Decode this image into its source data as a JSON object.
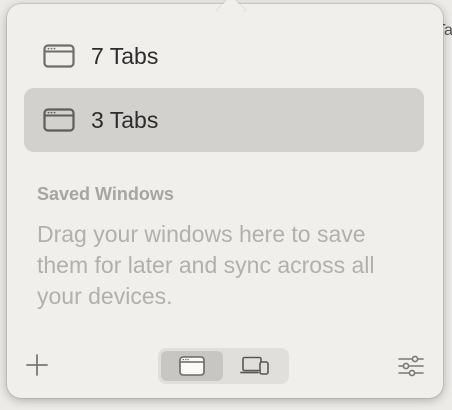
{
  "background": {
    "partial_text": "Ta"
  },
  "popover": {
    "tab_groups": [
      {
        "label": "7 Tabs",
        "icon": "browser-window-icon",
        "selected": false
      },
      {
        "label": "3 Tabs",
        "icon": "browser-window-icon",
        "selected": true
      }
    ],
    "saved_windows": {
      "title": "Saved Windows",
      "description": "Drag your windows here to save them for later and sync across all your devices."
    },
    "toolbar": {
      "add_icon": "plus-icon",
      "segments": [
        {
          "icon": "browser-window-icon",
          "active": true
        },
        {
          "icon": "devices-icon",
          "active": false
        }
      ],
      "settings_icon": "sliders-icon"
    }
  },
  "colors": {
    "popover_bg": "#f1efeb",
    "selected_row": "#d3d1ce",
    "muted_text": "#b2b0ac"
  }
}
